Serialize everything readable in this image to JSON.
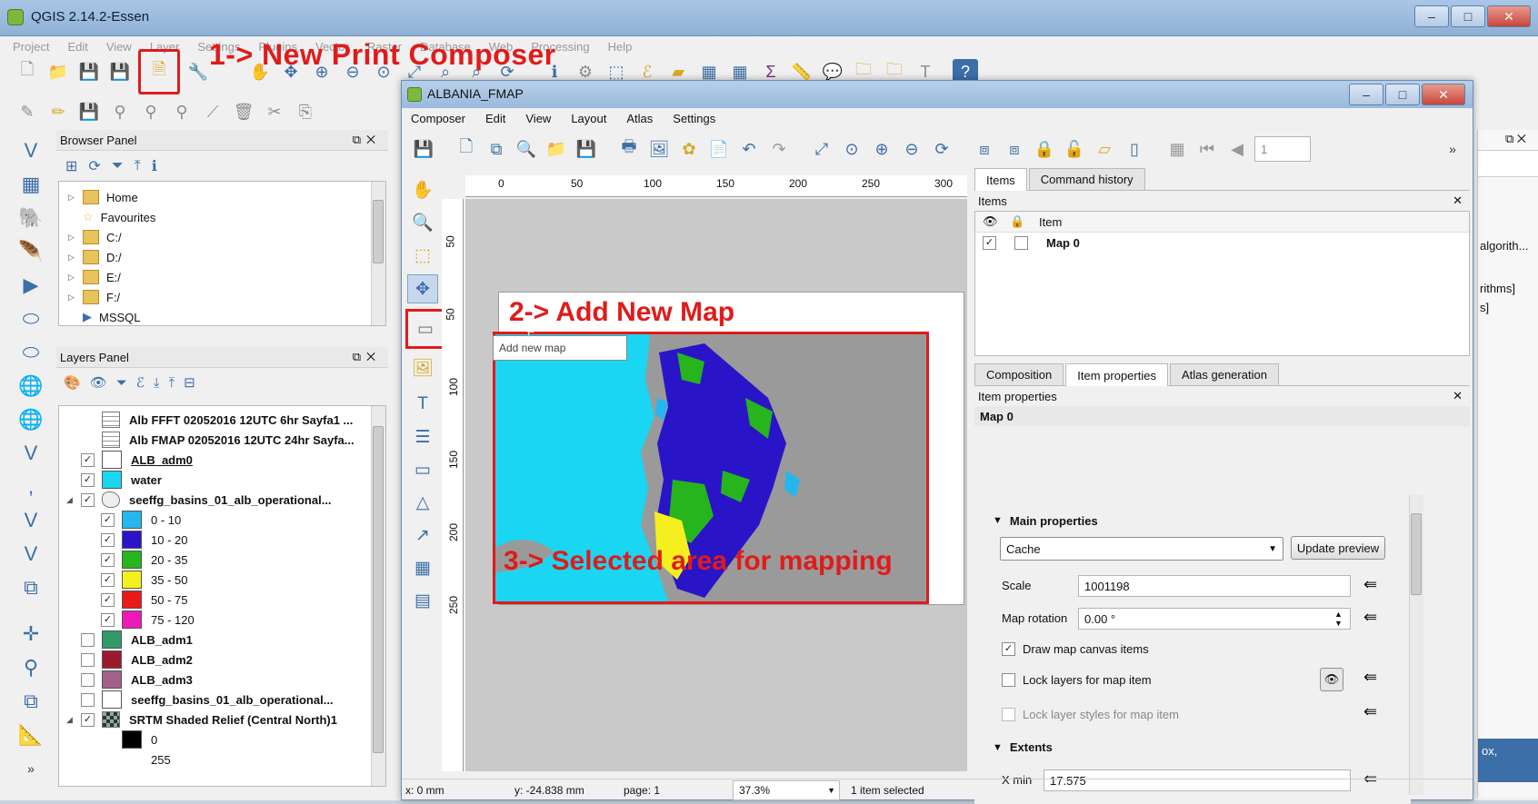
{
  "qgis": {
    "title": "QGIS 2.14.2-Essen",
    "menu": [
      "Project",
      "Edit",
      "View",
      "Layer",
      "Settings",
      "Plugins",
      "Vector",
      "Raster",
      "Database",
      "Web",
      "Processing",
      "Help"
    ],
    "browser_panel": {
      "title": "Browser Panel",
      "items": [
        {
          "label": "Home"
        },
        {
          "label": "Favourites"
        },
        {
          "label": "C:/"
        },
        {
          "label": "D:/"
        },
        {
          "label": "E:/"
        },
        {
          "label": "F:/"
        },
        {
          "label": "MSSQL"
        }
      ]
    },
    "layers_panel": {
      "title": "Layers Panel",
      "layers": [
        {
          "label": "Alb FFFT 02052016 12UTC 6hr Sayfa1 ..."
        },
        {
          "label": "Alb FMAP 02052016 12UTC 24hr Sayfa..."
        },
        {
          "label": "ALB_adm0"
        },
        {
          "label": "water"
        },
        {
          "label": "seeffg_basins_01_alb_operational..."
        },
        {
          "label": "0 - 10"
        },
        {
          "label": "10 - 20"
        },
        {
          "label": "20 - 35"
        },
        {
          "label": "35 - 50"
        },
        {
          "label": "50 - 75"
        },
        {
          "label": "75 - 120"
        },
        {
          "label": "ALB_adm1"
        },
        {
          "label": "ALB_adm2"
        },
        {
          "label": "ALB_adm3"
        },
        {
          "label": "seeffg_basins_01_alb_operational..."
        },
        {
          "label": "SRTM Shaded Relief (Central North)1"
        },
        {
          "label": "0"
        },
        {
          "label": "255"
        }
      ]
    },
    "right_fragments": [
      "algorith...",
      "rithms]",
      "s]",
      "ox,"
    ]
  },
  "colors": {
    "water": "#1ad6f2",
    "c0_10": "#25b6f0",
    "c10_20": "#2a14c8",
    "c20_35": "#26b51c",
    "c35_50": "#f5f01d",
    "c50_75": "#ea1a1a",
    "c75_120": "#ee1ab8",
    "adm1": "#2f9a68",
    "adm2": "#9b1b2c",
    "adm3": "#a3608a",
    "annotation": "#e01b1b"
  },
  "annotations": {
    "step1": "1-> New Print Composer",
    "step2": "2-> Add New Map",
    "step3": "3-> Selected area for mapping"
  },
  "composer": {
    "title": "ALBANIA_FMAP",
    "menu": [
      "Composer",
      "Edit",
      "View",
      "Layout",
      "Atlas",
      "Settings"
    ],
    "page_input": "1",
    "tooltip": "Add new map",
    "hruler_ticks": [
      "0",
      "50",
      "100",
      "150",
      "200",
      "250",
      "300"
    ],
    "vruler_ticks": [
      "50",
      "50",
      "100",
      "150",
      "200",
      "250"
    ],
    "panel": {
      "top_tabs": [
        "Items",
        "Command history"
      ],
      "items_title": "Items",
      "items_header": "Item",
      "item_name": "Map 0",
      "bottom_tabs": [
        "Composition",
        "Item properties",
        "Atlas generation"
      ],
      "props_title": "Item properties",
      "props_item": "Map 0",
      "main_properties": "Main properties",
      "cache_select": "Cache",
      "update_preview": "Update preview",
      "scale_label": "Scale",
      "scale_value": "1001198",
      "rotation_label": "Map rotation",
      "rotation_value": "0.00 °",
      "draw_canvas": "Draw map canvas items",
      "lock_layers": "Lock layers for map item",
      "lock_styles": "Lock layer styles for map item",
      "extents": "Extents",
      "xmin_label": "X min",
      "xmin_value": "17.575"
    },
    "status": {
      "x": "x: 0 mm",
      "y": "y: -24.838 mm",
      "page": "page: 1",
      "zoom": "37.3%",
      "selection": "1 item selected"
    }
  }
}
